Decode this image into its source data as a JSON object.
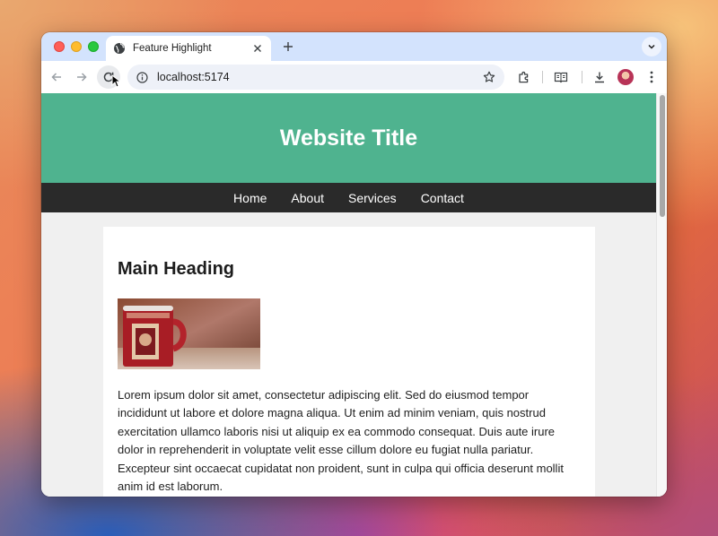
{
  "browser": {
    "tab": {
      "title": "Feature Highlight"
    },
    "address": {
      "url": "localhost:5174"
    }
  },
  "site": {
    "title": "Website Title",
    "nav": [
      "Home",
      "About",
      "Services",
      "Contact"
    ],
    "main": {
      "heading": "Main Heading",
      "image_alt": "red mug",
      "paragraph": "Lorem ipsum dolor sit amet, consectetur adipiscing elit. Sed do eiusmod tempor incididunt ut labore et dolore magna aliqua. Ut enim ad minim veniam, quis nostrud exercitation ullamco laboris nisi ut aliquip ex ea commodo consequat. Duis aute irure dolor in reprehenderit in voluptate velit esse cillum dolore eu fugiat nulla pariatur. Excepteur sint occaecat cupidatat non proident, sunt in culpa qui officia deserunt mollit anim id est laborum."
    }
  },
  "colors": {
    "header_bg": "#4fb38f",
    "nav_bg": "#2a2a2a",
    "tabbar_bg": "#d3e3fd",
    "page_bg": "#f0f0f0"
  },
  "icons": [
    "globe-icon",
    "close-icon",
    "plus-icon",
    "chevron-down-icon",
    "back-icon",
    "forward-icon",
    "reload-icon",
    "info-icon",
    "star-icon",
    "extensions-icon",
    "reading-mode-icon",
    "download-icon",
    "menu-icon"
  ]
}
